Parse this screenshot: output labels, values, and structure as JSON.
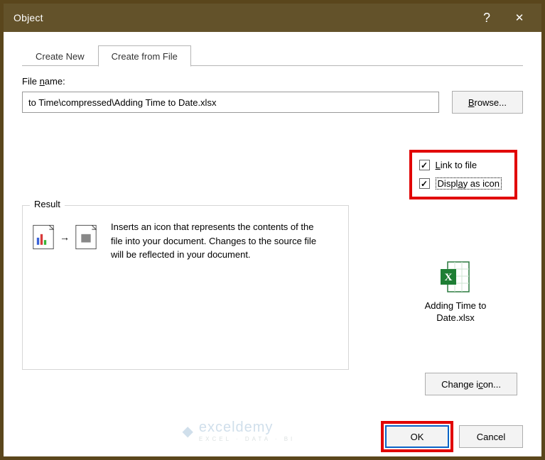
{
  "titlebar": {
    "title": "Object",
    "help_tooltip": "?",
    "close_tooltip": "✕"
  },
  "tabs": {
    "create_new": "Create New",
    "create_from_file": "Create from File"
  },
  "filename": {
    "label": "File name:",
    "value": "to Time\\compressed\\Adding Time to Date.xlsx"
  },
  "buttons": {
    "browse": "Browse...",
    "change_icon": "Change icon...",
    "ok": "OK",
    "cancel": "Cancel"
  },
  "checkboxes": {
    "link": {
      "label": "Link to file",
      "checked": true
    },
    "display_icon": {
      "label": "Display as icon",
      "checked": true
    }
  },
  "result": {
    "legend": "Result",
    "description": "Inserts an icon that represents the contents of the file into your document. Changes to the source file will be reflected in your document."
  },
  "icon_preview": {
    "filename": "Adding Time to Date.xlsx"
  },
  "watermark": {
    "brand": "exceldemy",
    "tagline": "EXCEL · DATA · BI"
  }
}
